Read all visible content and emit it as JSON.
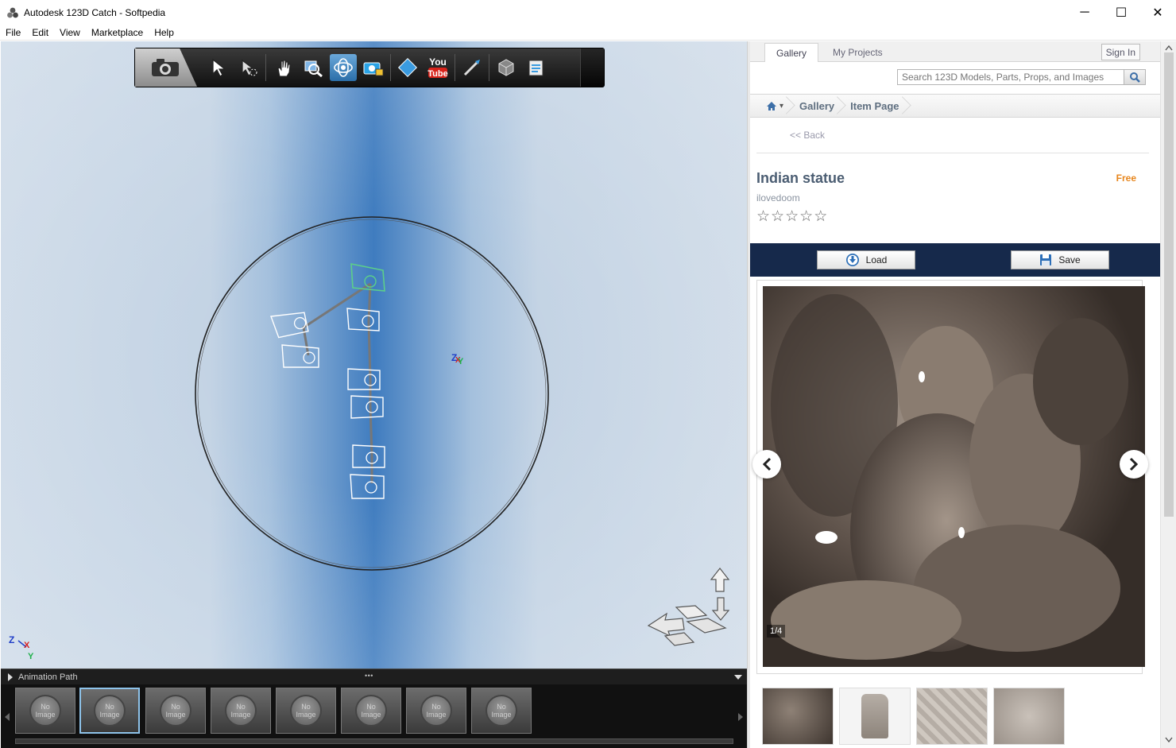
{
  "window": {
    "title": "Autodesk 123D Catch - Softpedia",
    "controls": {
      "minimize": "─",
      "maximize": "☐",
      "close": "✕"
    }
  },
  "menu": [
    "File",
    "Edit",
    "View",
    "Marketplace",
    "Help"
  ],
  "toolbar": {
    "tools": [
      "select-icon",
      "select-lasso-icon",
      "pan-icon",
      "zoom-icon",
      "orbit-icon",
      "camera-lock-icon",
      "animation-icon",
      "youtube-icon",
      "pen-icon",
      "mesh-export-icon",
      "notes-icon"
    ],
    "active_tool": "orbit-icon",
    "youtube_top": "You",
    "youtube_bottom": "Tube"
  },
  "viewport": {
    "axis_labels": {
      "z": "Z",
      "x": "X",
      "y": "Y"
    },
    "pivot_labels": {
      "z": "Z",
      "x": "X",
      "y": "Y"
    }
  },
  "animation_path": {
    "label": "Animation Path",
    "handle": "• • •",
    "thumbnails": [
      {
        "text": "No Image"
      },
      {
        "text": "No Image"
      },
      {
        "text": "No Image"
      },
      {
        "text": "No Image"
      },
      {
        "text": "No Image"
      },
      {
        "text": "No Image"
      },
      {
        "text": "No Image"
      },
      {
        "text": "No Image"
      }
    ],
    "selected_index": 1
  },
  "panel": {
    "tabs": [
      {
        "label": "Gallery"
      },
      {
        "label": "My Projects"
      }
    ],
    "sign_in": "Sign In",
    "search_placeholder": "Search 123D Models, Parts, Props, and Images",
    "breadcrumb": {
      "home": "▾",
      "gallery": "Gallery",
      "item": "Item Page"
    },
    "back": "<< Back",
    "item": {
      "title": "Indian statue",
      "price": "Free",
      "author": "ilovedoom",
      "rating": 0,
      "max_rating": 5,
      "stars": [
        "☆",
        "☆",
        "☆",
        "☆",
        "☆"
      ]
    },
    "buttons": {
      "load": "Load",
      "save": "Save"
    },
    "image_counter": "1/4",
    "colors": {
      "accent": "#e7851b",
      "action_bar": "#16294b",
      "title": "#4b5d72"
    }
  }
}
